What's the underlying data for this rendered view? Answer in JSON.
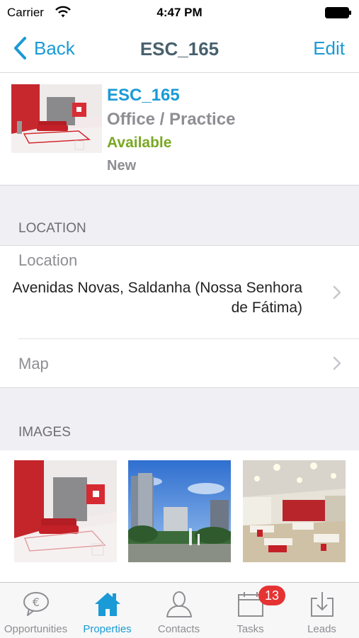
{
  "status_bar": {
    "carrier": "Carrier",
    "time": "4:47 PM"
  },
  "nav": {
    "back_label": "Back",
    "title": "ESC_165",
    "edit_label": "Edit"
  },
  "property": {
    "code": "ESC_165",
    "type": "Office / Practice",
    "status": "Available",
    "condition": "New"
  },
  "location_section": {
    "header": "LOCATION",
    "label": "Location",
    "value": "Avenidas Novas, Saldanha (Nossa Senhora de Fátima)",
    "map_label": "Map"
  },
  "images_section": {
    "header": "IMAGES"
  },
  "tabs": [
    {
      "label": "Opportunities",
      "icon": "euro-bubble-icon",
      "active": false
    },
    {
      "label": "Properties",
      "icon": "house-icon",
      "active": true
    },
    {
      "label": "Contacts",
      "icon": "person-icon",
      "active": false
    },
    {
      "label": "Tasks",
      "icon": "calendar-icon",
      "active": false,
      "badge": "13"
    },
    {
      "label": "Leads",
      "icon": "download-tray-icon",
      "active": false
    }
  ],
  "colors": {
    "accent": "#1a9ad6",
    "available": "#7aa823",
    "badge": "#e53333"
  }
}
